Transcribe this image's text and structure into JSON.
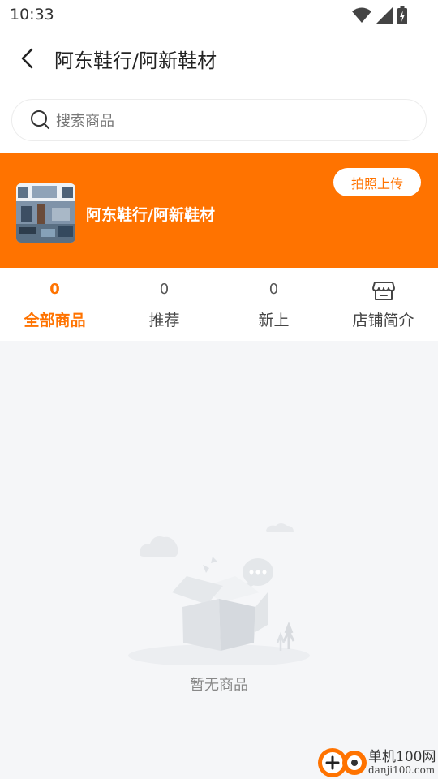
{
  "status_bar": {
    "time": "10:33",
    "icons": [
      "wifi-icon",
      "signal-icon",
      "battery-icon"
    ]
  },
  "header": {
    "back_icon": "chevron-left-icon",
    "title": "阿东鞋行/阿新鞋材"
  },
  "search": {
    "icon": "search-icon",
    "placeholder": "搜索商品",
    "value": ""
  },
  "shop": {
    "name": "阿东鞋行/阿新鞋材",
    "upload_button": "拍照上传",
    "banner_color": "#ff7300"
  },
  "tabs": [
    {
      "count": "0",
      "label": "全部商品",
      "active": true
    },
    {
      "count": "0",
      "label": "推荐",
      "active": false
    },
    {
      "count": "0",
      "label": "新上",
      "active": false
    },
    {
      "icon": "store-icon",
      "label": "店铺简介",
      "active": false
    }
  ],
  "empty_state": {
    "illustration": "empty-box-illustration",
    "text": "暂无商品"
  },
  "watermark": {
    "brand": "单机100网",
    "url": "danji100.com"
  },
  "colors": {
    "accent": "#ff7300",
    "background": "#f5f6f8"
  }
}
